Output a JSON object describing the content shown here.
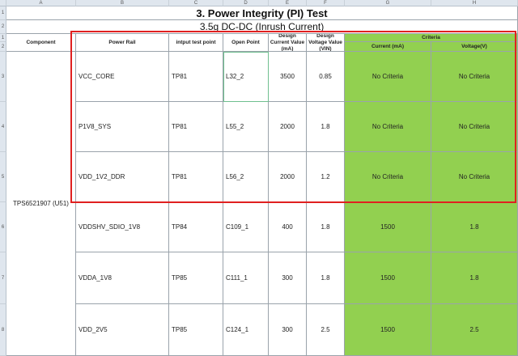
{
  "columns": [
    "A",
    "B",
    "C",
    "D",
    "E",
    "F",
    "G",
    "H"
  ],
  "rows": [
    "1",
    "2",
    "1",
    "2",
    "3",
    "4",
    "5",
    "6",
    "7",
    "8"
  ],
  "title": "3. Power Integrity (PI) Test",
  "subtitle": "3.5g DC-DC (Inrush Current)",
  "headers": {
    "component": "Component",
    "power_rail": "Power Rail",
    "input_test_point": "intput test point",
    "open_point": "Open  Point",
    "design_current": "Design Current Value (mA)",
    "design_voltage": "Design Voltage Value (VIN)",
    "criteria": "Criteria",
    "criteria_current": "Current (mA)",
    "criteria_voltage": "Voltage(V)"
  },
  "component_name": "TPS6521907 (U51)",
  "data_rows": [
    {
      "rail": "VCC_CORE",
      "tp": "TP81",
      "open": "L32_2",
      "current": "3500",
      "voltage": "0.85",
      "crit_current": "No Criteria",
      "crit_voltage": "No Criteria"
    },
    {
      "rail": "P1V8_SYS",
      "tp": "TP81",
      "open": "L55_2",
      "current": "2000",
      "voltage": "1.8",
      "crit_current": "No Criteria",
      "crit_voltage": "No Criteria"
    },
    {
      "rail": "VDD_1V2_DDR",
      "tp": "TP81",
      "open": "L56_2",
      "current": "2000",
      "voltage": "1.2",
      "crit_current": "No Criteria",
      "crit_voltage": "No Criteria"
    },
    {
      "rail": "VDDSHV_SDIO_1V8",
      "tp": "TP84",
      "open": "C109_1",
      "current": "400",
      "voltage": "1.8",
      "crit_current": "1500",
      "crit_voltage": "1.8"
    },
    {
      "rail": "VDDA_1V8",
      "tp": "TP85",
      "open": "C111_1",
      "current": "300",
      "voltage": "1.8",
      "crit_current": "1500",
      "crit_voltage": "1.8"
    },
    {
      "rail": "VDD_2V5",
      "tp": "TP85",
      "open": "C124_1",
      "current": "300",
      "voltage": "2.5",
      "crit_current": "1500",
      "crit_voltage": "2.5"
    }
  ]
}
